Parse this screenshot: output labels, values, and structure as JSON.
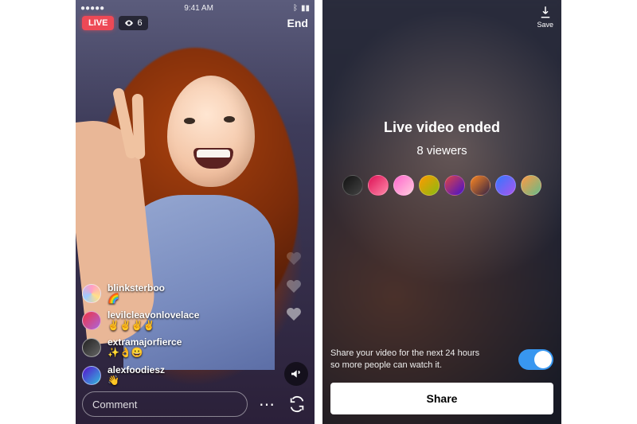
{
  "left": {
    "status": {
      "time": "9:41 AM"
    },
    "live_label": "LIVE",
    "viewer_count": "6",
    "end_label": "End",
    "comments": [
      {
        "user": "blinksterboo",
        "body": "🌈"
      },
      {
        "user": "levilcleavonlovelace",
        "body": "✌️✌️✌️✌️"
      },
      {
        "user": "extramajorfierce",
        "body": "✨👌😀"
      },
      {
        "user": "alexfoodiesz",
        "body": "👋"
      }
    ],
    "comment_placeholder": "Comment"
  },
  "right": {
    "save_label": "Save",
    "title": "Live video ended",
    "viewers_line": "8 viewers",
    "share_description": "Share your video for the next 24 hours so more people can watch it.",
    "share_button": "Share"
  }
}
